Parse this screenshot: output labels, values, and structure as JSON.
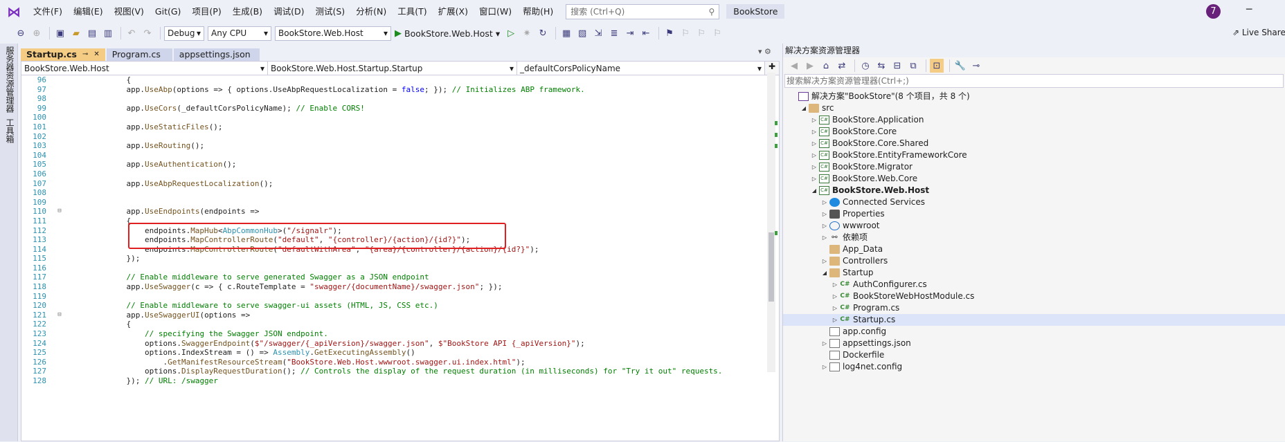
{
  "menubar": {
    "items": [
      "文件(F)",
      "编辑(E)",
      "视图(V)",
      "Git(G)",
      "项目(P)",
      "生成(B)",
      "调试(D)",
      "测试(S)",
      "分析(N)",
      "工具(T)",
      "扩展(X)",
      "窗口(W)",
      "帮助(H)"
    ],
    "search_placeholder": "搜索 (Ctrl+Q)",
    "app_title": "BookStore",
    "avatar": "7"
  },
  "toolbar": {
    "config": "Debug",
    "platform": "Any CPU",
    "startup_project": "BookStore.Web.Host",
    "run_label": "BookStore.Web.Host",
    "live_share": "Live Share"
  },
  "left_strip": [
    "服务器资源管理器",
    "工具箱"
  ],
  "tabs": [
    {
      "label": "Startup.cs",
      "active": true
    },
    {
      "label": "Program.cs",
      "active": false
    },
    {
      "label": "appsettings.json",
      "active": false
    }
  ],
  "navbar": {
    "project": "BookStore.Web.Host",
    "type": "BookStore.Web.Host.Startup.Startup",
    "member": "_defaultCorsPolicyName"
  },
  "code_lines": [
    {
      "n": "96",
      "t": "            {"
    },
    {
      "n": "97",
      "t": "            app.UseAbp(options => { options.UseAbpRequestLocalization = false; }); // Initializes ABP framework."
    },
    {
      "n": "98",
      "t": ""
    },
    {
      "n": "99",
      "t": "            app.UseCors(_defaultCorsPolicyName); // Enable CORS!"
    },
    {
      "n": "100",
      "t": ""
    },
    {
      "n": "101",
      "t": "            app.UseStaticFiles();"
    },
    {
      "n": "102",
      "t": ""
    },
    {
      "n": "103",
      "t": "            app.UseRouting();"
    },
    {
      "n": "104",
      "t": ""
    },
    {
      "n": "105",
      "t": "            app.UseAuthentication();"
    },
    {
      "n": "106",
      "t": ""
    },
    {
      "n": "107",
      "t": "            app.UseAbpRequestLocalization();"
    },
    {
      "n": "108",
      "t": ""
    },
    {
      "n": "109",
      "t": ""
    },
    {
      "n": "110",
      "t": "            app.UseEndpoints(endpoints =>"
    },
    {
      "n": "111",
      "t": "            {"
    },
    {
      "n": "112",
      "t": "                endpoints.MapHub<AbpCommonHub>(\"/signalr\");"
    },
    {
      "n": "113",
      "t": "                endpoints.MapControllerRoute(\"default\", \"{controller}/{action}/{id?}\");"
    },
    {
      "n": "114",
      "t": "                endpoints.MapControllerRoute(\"defaultWithArea\", \"{area}/{controller}/{action}/{id?}\");"
    },
    {
      "n": "115",
      "t": "            });"
    },
    {
      "n": "116",
      "t": ""
    },
    {
      "n": "117",
      "t": "            // Enable middleware to serve generated Swagger as a JSON endpoint"
    },
    {
      "n": "118",
      "t": "            app.UseSwagger(c => { c.RouteTemplate = \"swagger/{documentName}/swagger.json\"; });"
    },
    {
      "n": "119",
      "t": ""
    },
    {
      "n": "120",
      "t": "            // Enable middleware to serve swagger-ui assets (HTML, JS, CSS etc.)"
    },
    {
      "n": "121",
      "t": "            app.UseSwaggerUI(options =>"
    },
    {
      "n": "122",
      "t": "            {"
    },
    {
      "n": "123",
      "t": "                // specifying the Swagger JSON endpoint."
    },
    {
      "n": "124",
      "t": "                options.SwaggerEndpoint($\"/swagger/{_apiVersion}/swagger.json\", $\"BookStore API {_apiVersion}\");"
    },
    {
      "n": "125",
      "t": "                options.IndexStream = () => Assembly.GetExecutingAssembly()"
    },
    {
      "n": "126",
      "t": "                    .GetManifestResourceStream(\"BookStore.Web.Host.wwwroot.swagger.ui.index.html\");"
    },
    {
      "n": "127",
      "t": "                options.DisplayRequestDuration(); // Controls the display of the request duration (in milliseconds) for \"Try it out\" requests."
    },
    {
      "n": "128",
      "t": "            }); // URL: /swagger"
    }
  ],
  "solution_explorer": {
    "title": "解决方案资源管理器",
    "search_placeholder": "搜索解决方案资源管理器(Ctrl+;)",
    "nodes": [
      {
        "label": "解决方案\"BookStore\"(8 个项目，共 8 个)",
        "indent": 0,
        "arrow": "",
        "icon": "sol",
        "bold": false
      },
      {
        "label": "src",
        "indent": 1,
        "arrow": "◢",
        "icon": "folder",
        "bold": false
      },
      {
        "label": "BookStore.Application",
        "indent": 2,
        "arrow": "▷",
        "icon": "proj",
        "bold": false
      },
      {
        "label": "BookStore.Core",
        "indent": 2,
        "arrow": "▷",
        "icon": "proj",
        "bold": false
      },
      {
        "label": "BookStore.Core.Shared",
        "indent": 2,
        "arrow": "▷",
        "icon": "proj",
        "bold": false
      },
      {
        "label": "BookStore.EntityFrameworkCore",
        "indent": 2,
        "arrow": "▷",
        "icon": "proj",
        "bold": false
      },
      {
        "label": "BookStore.Migrator",
        "indent": 2,
        "arrow": "▷",
        "icon": "proj",
        "bold": false
      },
      {
        "label": "BookStore.Web.Core",
        "indent": 2,
        "arrow": "▷",
        "icon": "proj",
        "bold": false
      },
      {
        "label": "BookStore.Web.Host",
        "indent": 2,
        "arrow": "◢",
        "icon": "proj",
        "bold": true
      },
      {
        "label": "Connected Services",
        "indent": 3,
        "arrow": "▷",
        "icon": "svc",
        "bold": false
      },
      {
        "label": "Properties",
        "indent": 3,
        "arrow": "▷",
        "icon": "prop",
        "bold": false
      },
      {
        "label": "wwwroot",
        "indent": 3,
        "arrow": "▷",
        "icon": "globe",
        "bold": false
      },
      {
        "label": "依赖项",
        "indent": 3,
        "arrow": "▷",
        "icon": "dep",
        "bold": false
      },
      {
        "label": "App_Data",
        "indent": 3,
        "arrow": "",
        "icon": "folder",
        "bold": false
      },
      {
        "label": "Controllers",
        "indent": 3,
        "arrow": "▷",
        "icon": "folder",
        "bold": false
      },
      {
        "label": "Startup",
        "indent": 3,
        "arrow": "◢",
        "icon": "folder",
        "bold": false
      },
      {
        "label": "AuthConfigurer.cs",
        "indent": 4,
        "arrow": "▷",
        "icon": "cs",
        "bold": false
      },
      {
        "label": "BookStoreWebHostModule.cs",
        "indent": 4,
        "arrow": "▷",
        "icon": "cs",
        "bold": false
      },
      {
        "label": "Program.cs",
        "indent": 4,
        "arrow": "▷",
        "icon": "cs",
        "bold": false
      },
      {
        "label": "Startup.cs",
        "indent": 4,
        "arrow": "▷",
        "icon": "cs",
        "bold": false,
        "selected": true
      },
      {
        "label": "app.config",
        "indent": 3,
        "arrow": "",
        "icon": "file",
        "bold": false
      },
      {
        "label": "appsettings.json",
        "indent": 3,
        "arrow": "▷",
        "icon": "file",
        "bold": false
      },
      {
        "label": "Dockerfile",
        "indent": 3,
        "arrow": "",
        "icon": "file",
        "bold": false
      },
      {
        "label": "log4net.config",
        "indent": 3,
        "arrow": "▷",
        "icon": "file",
        "bold": false
      }
    ]
  }
}
